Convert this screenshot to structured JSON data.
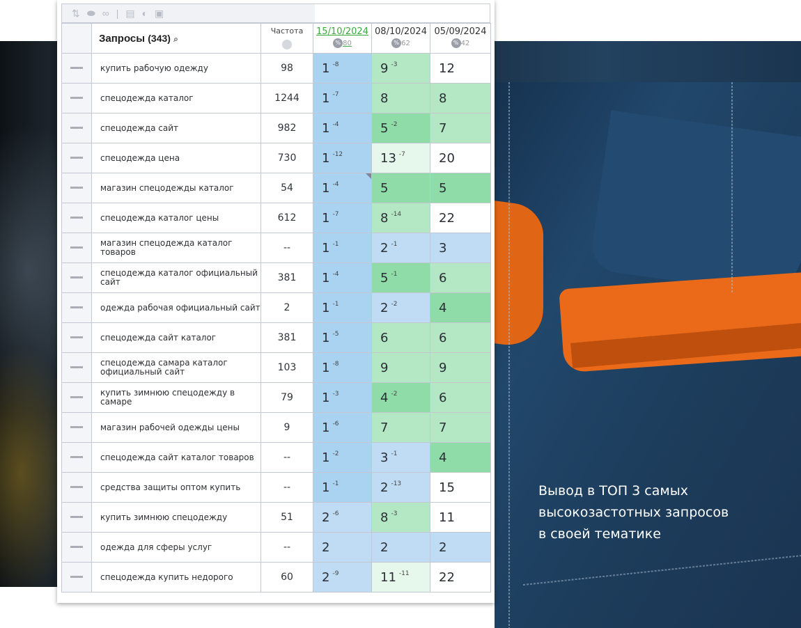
{
  "caption": [
    "Вывод в ТОП 3 самых",
    "высокозастотных запросов",
    "в своей тематике"
  ],
  "table": {
    "header": {
      "queries_label": "Запросы",
      "queries_count": "(343)",
      "frequency_label": "Частота",
      "dates": [
        {
          "date": "15/10/2024",
          "pct": "%",
          "count": "80"
        },
        {
          "date": "08/10/2024",
          "pct": "%",
          "count": "62"
        },
        {
          "date": "05/09/2024",
          "pct": "%",
          "count": "42"
        }
      ]
    },
    "rows": [
      {
        "query": "купить рабочую одежду",
        "freq": "98",
        "p": [
          {
            "v": "1",
            "d": "-8",
            "c": "col1"
          },
          {
            "v": "9",
            "d": "-3",
            "c": "lgreen"
          },
          {
            "v": "12",
            "d": "",
            "c": "white"
          }
        ]
      },
      {
        "query": "спецодежда каталог",
        "freq": "1244",
        "p": [
          {
            "v": "1",
            "d": "-7",
            "c": "col1"
          },
          {
            "v": "8",
            "d": "",
            "c": "lgreen"
          },
          {
            "v": "8",
            "d": "",
            "c": "lgreen"
          }
        ]
      },
      {
        "query": "спецодежда сайт",
        "freq": "982",
        "p": [
          {
            "v": "1",
            "d": "-4",
            "c": "col1"
          },
          {
            "v": "5",
            "d": "-2",
            "c": "green"
          },
          {
            "v": "7",
            "d": "",
            "c": "lgreen"
          }
        ]
      },
      {
        "query": "спецодежда цена",
        "freq": "730",
        "p": [
          {
            "v": "1",
            "d": "-12",
            "c": "col1"
          },
          {
            "v": "13",
            "d": "-7",
            "c": "vlgreen"
          },
          {
            "v": "20",
            "d": "",
            "c": "white"
          }
        ]
      },
      {
        "query": "магазин спецодежды каталог",
        "freq": "54",
        "p": [
          {
            "v": "1",
            "d": "-4",
            "c": "col1"
          },
          {
            "v": "5",
            "d": "",
            "c": "green"
          },
          {
            "v": "5",
            "d": "",
            "c": "green"
          }
        ]
      },
      {
        "query": "спецодежда каталог цены",
        "freq": "612",
        "p": [
          {
            "v": "1",
            "d": "-7",
            "c": "col1"
          },
          {
            "v": "8",
            "d": "-14",
            "c": "lgreen"
          },
          {
            "v": "22",
            "d": "",
            "c": "white"
          }
        ]
      },
      {
        "query": "магазин спецодежда каталог товаров",
        "freq": "--",
        "p": [
          {
            "v": "1",
            "d": "-1",
            "c": "col1"
          },
          {
            "v": "2",
            "d": "-1",
            "c": "blue"
          },
          {
            "v": "3",
            "d": "",
            "c": "blue"
          }
        ]
      },
      {
        "query": "спецодежда каталог официальный сайт",
        "freq": "381",
        "p": [
          {
            "v": "1",
            "d": "-4",
            "c": "col1"
          },
          {
            "v": "5",
            "d": "-1",
            "c": "green"
          },
          {
            "v": "6",
            "d": "",
            "c": "lgreen"
          }
        ]
      },
      {
        "query": "одежда рабочая официальный сайт",
        "freq": "2",
        "p": [
          {
            "v": "1",
            "d": "-1",
            "c": "col1"
          },
          {
            "v": "2",
            "d": "-2",
            "c": "blue"
          },
          {
            "v": "4",
            "d": "",
            "c": "green"
          }
        ]
      },
      {
        "query": "спецодежда сайт каталог",
        "freq": "381",
        "p": [
          {
            "v": "1",
            "d": "-5",
            "c": "col1"
          },
          {
            "v": "6",
            "d": "",
            "c": "lgreen"
          },
          {
            "v": "6",
            "d": "",
            "c": "lgreen"
          }
        ]
      },
      {
        "query": "спецодежда самара каталог официальный сайт",
        "freq": "103",
        "p": [
          {
            "v": "1",
            "d": "-8",
            "c": "col1"
          },
          {
            "v": "9",
            "d": "",
            "c": "lgreen"
          },
          {
            "v": "9",
            "d": "",
            "c": "lgreen"
          }
        ]
      },
      {
        "query": "купить зимнюю спецодежду в самаре",
        "freq": "79",
        "p": [
          {
            "v": "1",
            "d": "-3",
            "c": "col1"
          },
          {
            "v": "4",
            "d": "-2",
            "c": "green"
          },
          {
            "v": "6",
            "d": "",
            "c": "lgreen"
          }
        ]
      },
      {
        "query": "магазин рабочей одежды цены",
        "freq": "9",
        "p": [
          {
            "v": "1",
            "d": "-6",
            "c": "col1"
          },
          {
            "v": "7",
            "d": "",
            "c": "lgreen"
          },
          {
            "v": "7",
            "d": "",
            "c": "lgreen"
          }
        ]
      },
      {
        "query": "спецодежда сайт каталог товаров",
        "freq": "--",
        "p": [
          {
            "v": "1",
            "d": "-2",
            "c": "col1"
          },
          {
            "v": "3",
            "d": "-1",
            "c": "blue"
          },
          {
            "v": "4",
            "d": "",
            "c": "green"
          }
        ]
      },
      {
        "query": "средства защиты оптом купить",
        "freq": "--",
        "p": [
          {
            "v": "1",
            "d": "-1",
            "c": "col1"
          },
          {
            "v": "2",
            "d": "-13",
            "c": "blue"
          },
          {
            "v": "15",
            "d": "",
            "c": "white"
          }
        ]
      },
      {
        "query": "купить зимнюю спецодежду",
        "freq": "51",
        "p": [
          {
            "v": "2",
            "d": "-6",
            "c": "blue"
          },
          {
            "v": "8",
            "d": "-3",
            "c": "lgreen"
          },
          {
            "v": "11",
            "d": "",
            "c": "white"
          }
        ]
      },
      {
        "query": "одежда для сферы услуг",
        "freq": "--",
        "p": [
          {
            "v": "2",
            "d": "",
            "c": "blue"
          },
          {
            "v": "2",
            "d": "",
            "c": "blue"
          },
          {
            "v": "2",
            "d": "",
            "c": "blue"
          }
        ]
      },
      {
        "query": "спецодежда купить недорого",
        "freq": "60",
        "p": [
          {
            "v": "2",
            "d": "-9",
            "c": "blue"
          },
          {
            "v": "11",
            "d": "-11",
            "c": "vlgreen"
          },
          {
            "v": "22",
            "d": "",
            "c": "white"
          }
        ]
      }
    ]
  },
  "colors": {
    "blue_cell": "#bfdcf4",
    "green_cell": "#8fdca8",
    "light_green_cell": "#b4e8c5",
    "date_link": "#3aaa3a"
  }
}
